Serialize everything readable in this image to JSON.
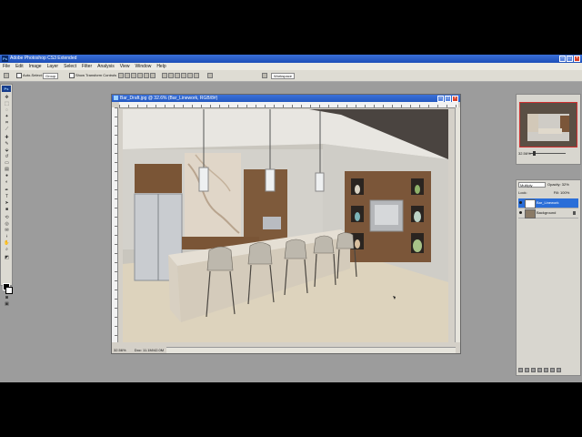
{
  "app": {
    "title": "Adobe Photoshop CS3 Extended",
    "logo": "Ps"
  },
  "menu": [
    "File",
    "Edit",
    "Image",
    "Layer",
    "Select",
    "Filter",
    "Analysis",
    "View",
    "Window",
    "Help"
  ],
  "options_bar": {
    "auto_select_label": "Auto-Select:",
    "auto_select_value": "Group",
    "transform_label": "Show Transform Controls",
    "workspace_label": "Workspace"
  },
  "document": {
    "title": "Bar_Draft.jpg @ 32.6% (Bar_Linework, RGB/8#)",
    "zoom": "32.56%",
    "doc_size": "Doc: 11.1M/42.0M"
  },
  "navigator": {
    "zoom": "32.56%"
  },
  "layers": {
    "blend_mode": "Multiply",
    "opacity_label": "Opacity:",
    "opacity_value": "32%",
    "lock_label": "Lock:",
    "fill_label": "Fill:",
    "fill_value": "100%",
    "items": [
      {
        "name": "Bar_Linework",
        "selected": true,
        "visible": true,
        "locked": false
      },
      {
        "name": "Background",
        "selected": false,
        "visible": true,
        "locked": true
      }
    ]
  },
  "colors": {
    "title_bar": "#2458c0",
    "selection": "#2a6ed8",
    "panel_bg": "#d8d6cf",
    "app_bg": "#9c9c9c"
  }
}
